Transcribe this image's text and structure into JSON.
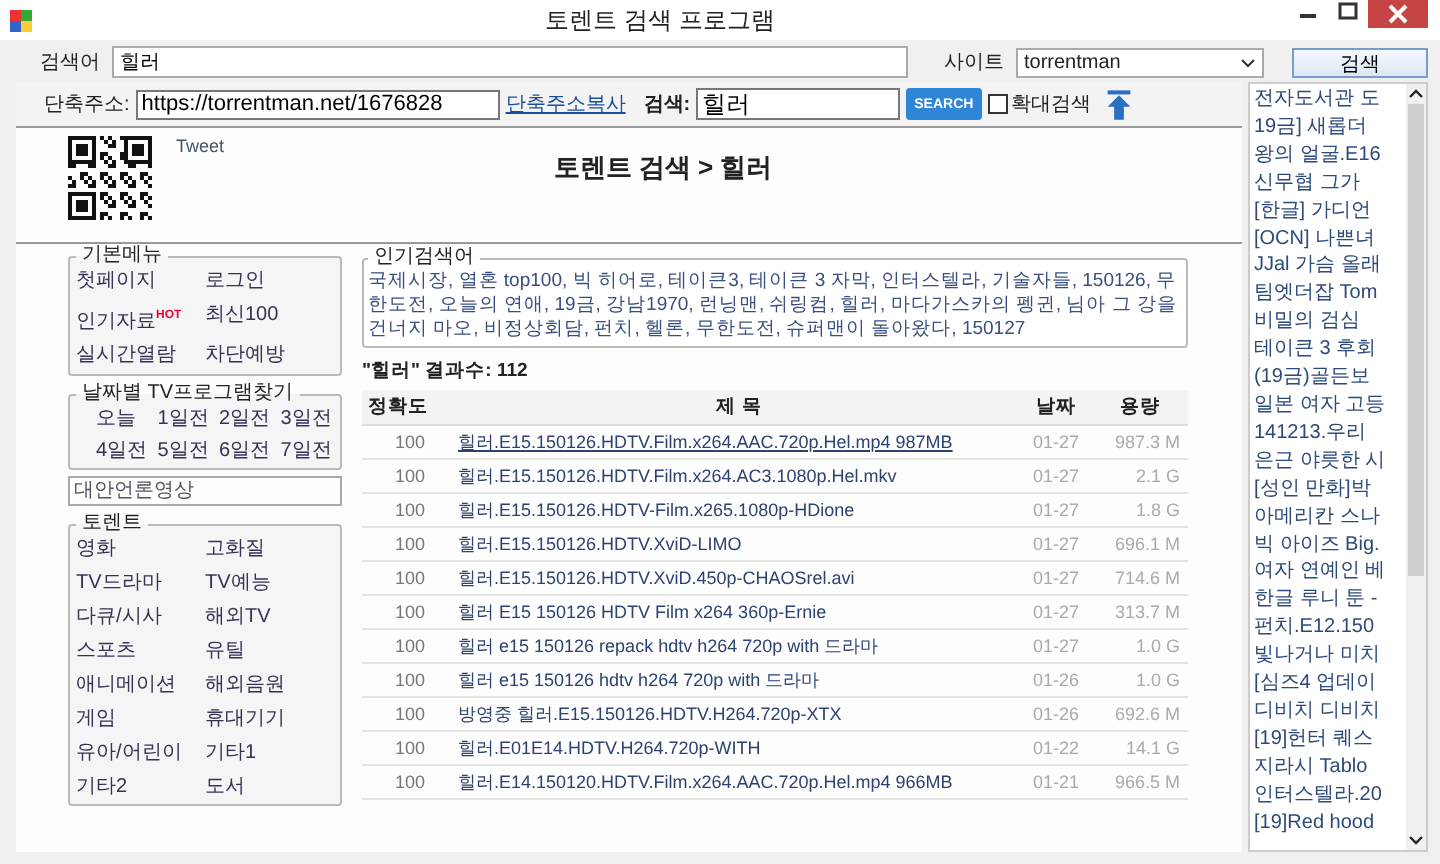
{
  "window": {
    "title": "토렌트 검색 프로그램"
  },
  "search_bar": {
    "label": "검색어",
    "value": "힐러",
    "site_label": "사이트",
    "site_value": "torrentman",
    "button": "검색"
  },
  "web_toolbar": {
    "short_url_label": "단축주소:",
    "short_url": "https://torrentman.net/1676828",
    "copy_link": "단축주소복사",
    "search_label": "검색:",
    "search_value": "힐러",
    "search_button": "SEARCH",
    "zoom_search": {
      "label": "확대검색",
      "checked": false
    }
  },
  "page": {
    "tweet": "Tweet",
    "heading": "토렌트 검색 > 힐러",
    "basic_menu": {
      "title": "기본메뉴",
      "items": [
        {
          "label": "첫페이지"
        },
        {
          "label": "로그인"
        },
        {
          "label": "인기자료",
          "badge": "HOT"
        },
        {
          "label": "최신100"
        },
        {
          "label": "실시간열람"
        },
        {
          "label": "차단예방"
        }
      ]
    },
    "tv_by_date": {
      "title": "날짜별 TV프로그램찾기",
      "items": [
        "오늘",
        "1일전",
        "2일전",
        "3일전",
        "4일전",
        "5일전",
        "6일전",
        "7일전"
      ]
    },
    "alt_media": "대안언론영상",
    "torrent_menu": {
      "title": "토렌트",
      "items": [
        "영화",
        "고화질",
        "TV드라마",
        "TV예능",
        "다큐/시사",
        "해외TV",
        "스포츠",
        "유틸",
        "애니메이션",
        "해외음원",
        "게임",
        "휴대기기",
        "유아/어린이",
        "기타1",
        "기타2",
        "도서"
      ]
    },
    "popular": {
      "title": "인기검색어",
      "text": "국제시장, 열혼 top100, 빅 히어로, 테이큰3, 테이큰 3 자막, 인터스텔라, 기술자들, 150126, 무한도전, 오늘의 연애, 19금, 강남1970, 런닝맨, 쉬링컴, 힐러, 마다가스카의 펭귄, 님아 그 강을 건너지 마오, 비정상회담, 펀치, 헬론, 무한도전, 슈퍼맨이 돌아왔다, 150127"
    },
    "result_count": "\"힐러\" 결과수: 112",
    "table": {
      "columns": [
        "정확도",
        "제 목",
        "날짜",
        "용량"
      ],
      "rows": [
        {
          "accuracy": "100",
          "title": "힐러.E15.150126.HDTV.Film.x264.AAC.720p.Hel.mp4 987MB",
          "date": "01-27",
          "size": "987.3 M",
          "hovered": true
        },
        {
          "accuracy": "100",
          "title": "힐러.E15.150126.HDTV.Film.x264.AC3.1080p.Hel.mkv",
          "date": "01-27",
          "size": "2.1 G",
          "hovered": false
        },
        {
          "accuracy": "100",
          "title": "힐러.E15.150126.HDTV-Film.x265.1080p-HDione",
          "date": "01-27",
          "size": "1.8 G",
          "hovered": false
        },
        {
          "accuracy": "100",
          "title": "힐러.E15.150126.HDTV.XviD-LIMO",
          "date": "01-27",
          "size": "696.1 M",
          "hovered": false
        },
        {
          "accuracy": "100",
          "title": "힐러.E15.150126.HDTV.XviD.450p-CHAOSrel.avi",
          "date": "01-27",
          "size": "714.6 M",
          "hovered": false
        },
        {
          "accuracy": "100",
          "title": "힐러 E15 150126 HDTV Film x264 360p-Ernie",
          "date": "01-27",
          "size": "313.7 M",
          "hovered": false
        },
        {
          "accuracy": "100",
          "title": "힐러 e15 150126 repack hdtv h264 720p with 드라마",
          "date": "01-27",
          "size": "1.0 G",
          "hovered": false
        },
        {
          "accuracy": "100",
          "title": "힐러 e15 150126 hdtv h264 720p with 드라마",
          "date": "01-26",
          "size": "1.0 G",
          "hovered": false
        },
        {
          "accuracy": "100",
          "title": "방영중 힐러.E15.150126.HDTV.H264.720p-XTX",
          "date": "01-26",
          "size": "692.6 M",
          "hovered": false
        },
        {
          "accuracy": "100",
          "title": "힐러.E01E14.HDTV.H264.720p-WITH",
          "date": "01-22",
          "size": "14.1 G",
          "hovered": false
        },
        {
          "accuracy": "100",
          "title": "힐러.E14.150120.HDTV.Film.x264.AAC.720p.Hel.mp4 966MB",
          "date": "01-21",
          "size": "966.5 M",
          "hovered": false
        }
      ]
    }
  },
  "side_list": [
    "전자도서관 도",
    "19금] 새롭더",
    "왕의 얼굴.E16",
    "신무협 그가",
    "[한글] 가디언",
    "[OCN] 나쁜녀",
    "JJal 가슴 올래",
    "팀엣더잡 Tom",
    "비밀의 검심",
    "테이큰 3 후회",
    "(19금)골든보",
    "일본 여자 고등",
    "141213.우리",
    "은근 야릇한 시",
    "[성인 만화]박",
    "아메리칸 스나",
    "빅 아이즈 Big.",
    "여자 연예인 베",
    "한글 루니 툰 -",
    "펀치.E12.150",
    "빛나거나 미치",
    "[심즈4 업데이",
    "디비치 디비치",
    "[19]헌터 퀘스",
    "지라시 Tablo",
    "인터스텔라.20",
    "[19]Red hood"
  ]
}
